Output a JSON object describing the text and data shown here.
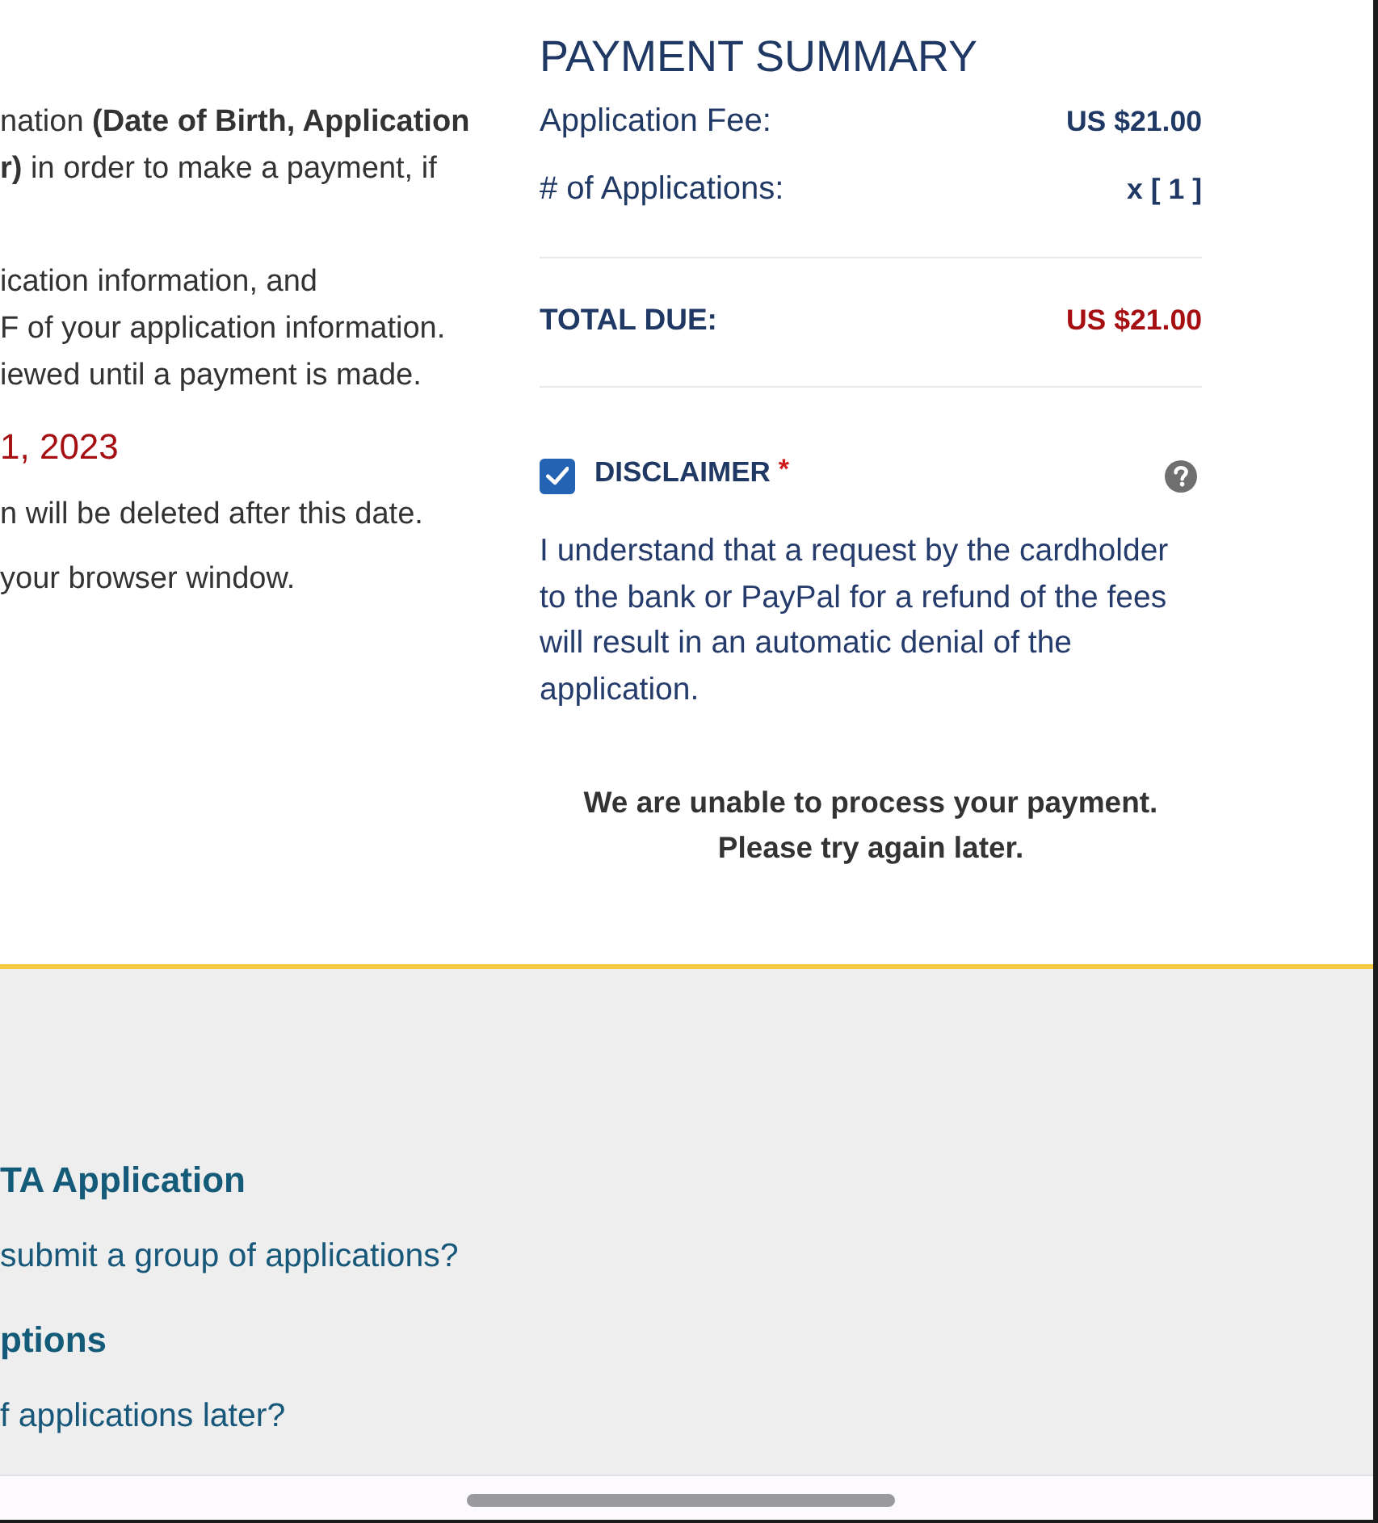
{
  "left_column": {
    "paragraph_1": [
      "nation **(Date of Birth, Application**",
      "**r)** in order to make a payment, if"
    ],
    "paragraph_2": [
      "ication information, and",
      "F of your application information.",
      "iewed until a payment is made."
    ],
    "deadline": "1, 2023",
    "deletion_note": "n will be deleted after this date.",
    "browser_note": "your browser window."
  },
  "payment_summary": {
    "title": "PAYMENT SUMMARY",
    "rows": [
      {
        "kind": "item",
        "label": "Application Fee:",
        "value": "US $21.00"
      },
      {
        "kind": "item",
        "label": "# of Applications:",
        "value": "x [ 1 ]"
      },
      {
        "kind": "total",
        "label": "TOTAL DUE:",
        "value": "US $21.00"
      }
    ]
  },
  "disclaimer": {
    "label": "DISCLAIMER",
    "required_mark": "*",
    "checked": true,
    "text": "I understand that a request by the cardholder to the bank or PayPal for a refund of the fees will result in an automatic denial of the application."
  },
  "error_message": [
    "We are unable to process your payment.",
    "Please try again later."
  ],
  "footer": {
    "sections": [
      {
        "heading": "TA Application",
        "links": [
          "submit a group of applications?"
        ]
      },
      {
        "heading": "ptions",
        "links": [
          "f applications later?"
        ]
      }
    ]
  }
}
